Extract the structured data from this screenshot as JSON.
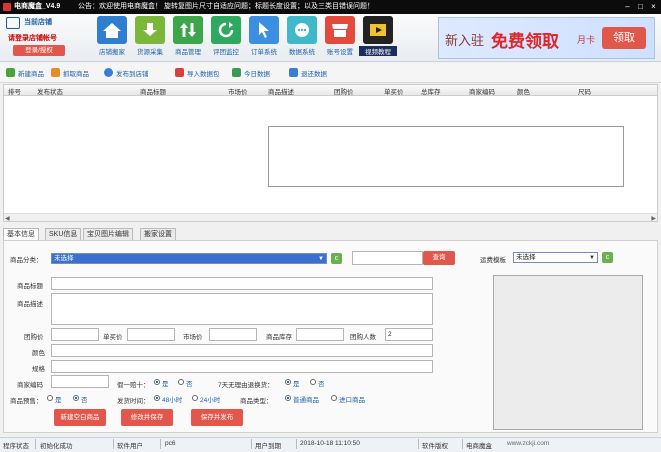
{
  "window": {
    "title": "电商魔盒_V4.9",
    "notice": "公告：欢迎使用电商魔盒！ 旋转复图片尺寸自适应问题；标题长度设置；以及三类目错误问题！"
  },
  "account": {
    "shop_label": "当前店铺",
    "login_tip": "请登录店铺帐号",
    "register_button": "登录/授权"
  },
  "toolbar": [
    {
      "label": "店铺搬家",
      "icon": "home-icon",
      "color": "#2f7fd1"
    },
    {
      "label": "货源采集",
      "icon": "download-icon",
      "color": "#7bb83a"
    },
    {
      "label": "商品管理",
      "icon": "sort-icon",
      "color": "#3da64a"
    },
    {
      "label": "评团监控",
      "icon": "refresh-icon",
      "color": "#2fa862"
    },
    {
      "label": "订单系统",
      "icon": "cursor-icon",
      "color": "#3a8fe0"
    },
    {
      "label": "数据系统",
      "icon": "chat-icon",
      "color": "#3fb9c9"
    },
    {
      "label": "账号设置",
      "icon": "shop-icon",
      "color": "#e24a3b"
    },
    {
      "label": "视频教程",
      "icon": "film-icon",
      "color": "#222222"
    }
  ],
  "ad": {
    "prefix": "新入驻",
    "headline": "免费领取",
    "suffix": "月卡",
    "button": "领取"
  },
  "subbar": [
    {
      "label": "新建商品",
      "color": "#4aa33a"
    },
    {
      "label": "抓取商品",
      "color": "#e38c2a"
    },
    {
      "label": "发布到店铺",
      "color": "#3a7ed4"
    },
    {
      "label": "导入数据包",
      "color": "#d84040"
    },
    {
      "label": "今日数据",
      "color": "#3a9a5a"
    },
    {
      "label": "退还数据",
      "color": "#3a7ed4"
    }
  ],
  "grid_columns": [
    "排号",
    "发布状态",
    "商品标题",
    "市场价",
    "商品描述",
    "团购价",
    "单买价",
    "总库存",
    "商家编码",
    "颜色",
    "尺码"
  ],
  "tabs": [
    "基本信息",
    "SKU信息",
    "宝贝图片编辑",
    "搬家设置"
  ],
  "form": {
    "category_label": "商品分类：",
    "category_value": "未选择",
    "search_button": "查询",
    "shipping_label": "运费模板",
    "shipping_value": "未选择",
    "title_label": "商品标题",
    "desc_label": "商品描述",
    "group_price_label": "团购价",
    "single_price_label": "单买价",
    "market_price_label": "市场价",
    "stock_label": "商品库存",
    "group_count_label": "团购人数",
    "group_count_value": "2",
    "color_label": "颜色",
    "spec_label": "规格",
    "code_label": "商家编码",
    "fake_label": "假一赔十：",
    "yes": "是",
    "no": "否",
    "return_label": "7天无理由退换货：",
    "presale_label": "商品预售：",
    "ship_time_label": "发货时间：",
    "ship_48": "48小时",
    "ship_24": "24小时",
    "goods_type_label": "商品类型：",
    "type_normal": "普通商品",
    "type_import": "进口商品",
    "btn_create": "新建空白商品",
    "btn_modify": "修改并保存",
    "btn_save": "保存并发布"
  },
  "statusbar": {
    "state_label": "程序状态",
    "state_value": "初始化成功",
    "user_label": "软件用户",
    "user_value": "pc6",
    "expire_label": "用户到期",
    "expire_value": "2018-10-18 11:10:50",
    "copyright_label": "软件版权",
    "copyright_value": "电商魔盒",
    "watermark": "www.zckji.com"
  }
}
